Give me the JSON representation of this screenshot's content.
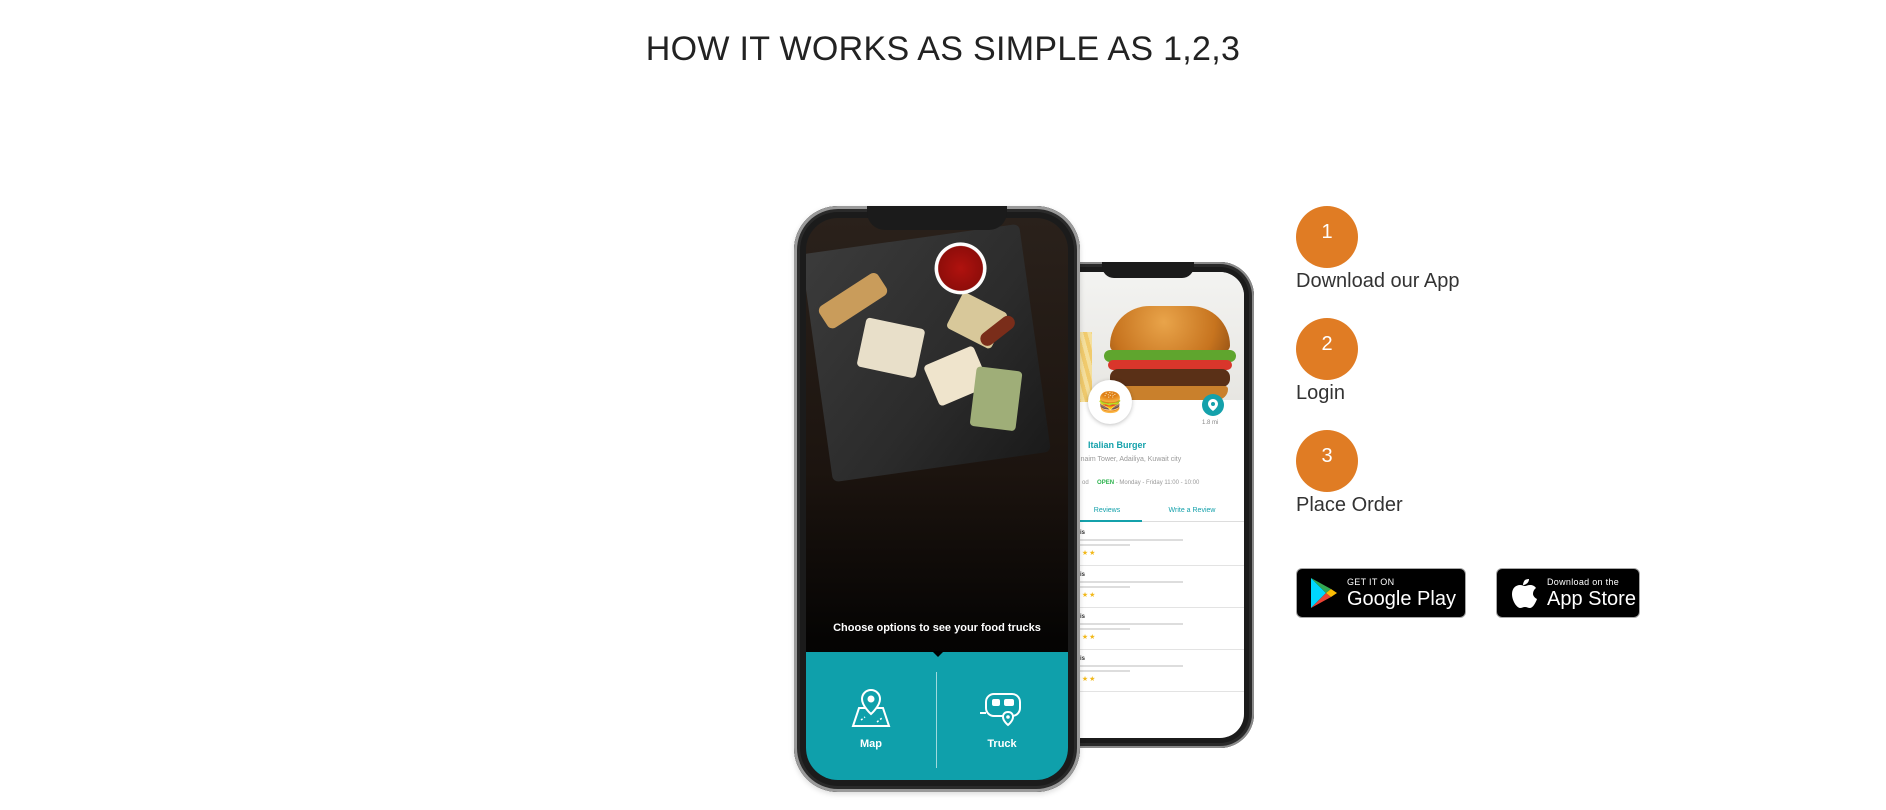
{
  "page": {
    "title": "HOW IT WORKS AS SIMPLE AS 1,2,3"
  },
  "phone_front": {
    "prompt": "Choose options to see your food trucks",
    "options": [
      {
        "label": "Map",
        "icon": "map-pin-icon"
      },
      {
        "label": "Truck",
        "icon": "food-truck-icon"
      }
    ]
  },
  "phone_back": {
    "restaurant_name": "Italian Burger",
    "address": "hunaim Tower, Adailiya, Kuwait city",
    "hours_prefix": "od",
    "status": "OPEN",
    "hours": " - Monday - Friday 11:00 - 10:00",
    "distance": "1.8 mi",
    "tabs": [
      "Reviews",
      "Write a Review"
    ],
    "reviews": [
      {
        "name": "en Denis",
        "stars": "★★★★★"
      },
      {
        "name": "en Denis",
        "stars": "★★★★★"
      },
      {
        "name": "en Denis",
        "stars": "★★★★★"
      },
      {
        "name": "en Denis",
        "stars": "★★★★★"
      }
    ]
  },
  "steps": [
    {
      "number": "1",
      "label": "Download our App"
    },
    {
      "number": "2",
      "label": "Login"
    },
    {
      "number": "3",
      "label": "Place Order"
    }
  ],
  "badges": {
    "google_play": {
      "small": "GET IT ON",
      "big": "Google Play"
    },
    "app_store": {
      "small": "Download on the",
      "big": "App Store"
    }
  },
  "colors": {
    "accent": "#e07c24",
    "teal": "#0fa0ab",
    "text": "#222222"
  }
}
